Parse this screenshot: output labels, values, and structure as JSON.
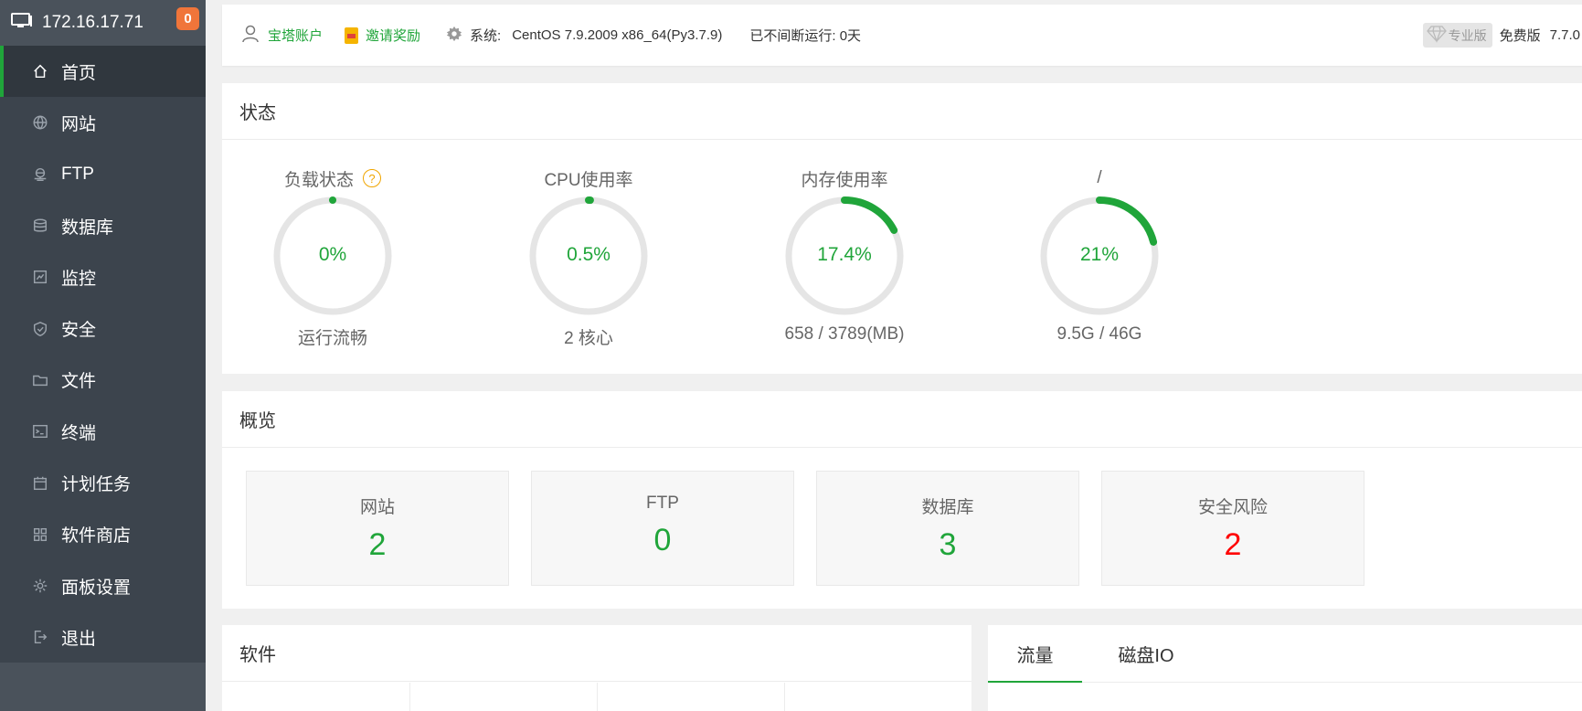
{
  "sidebar": {
    "ip": "172.16.17.71",
    "badge": "0",
    "items": [
      {
        "label": "首页",
        "icon": "home-icon"
      },
      {
        "label": "网站",
        "icon": "globe-icon"
      },
      {
        "label": "FTP",
        "icon": "ftp-icon"
      },
      {
        "label": "数据库",
        "icon": "database-icon"
      },
      {
        "label": "监控",
        "icon": "monitor-icon"
      },
      {
        "label": "安全",
        "icon": "shield-icon"
      },
      {
        "label": "文件",
        "icon": "folder-icon"
      },
      {
        "label": "终端",
        "icon": "terminal-icon"
      },
      {
        "label": "计划任务",
        "icon": "calendar-icon"
      },
      {
        "label": "软件商店",
        "icon": "apps-icon"
      },
      {
        "label": "面板设置",
        "icon": "gear-icon"
      },
      {
        "label": "退出",
        "icon": "logout-icon"
      }
    ]
  },
  "header": {
    "account": "宝塔账户",
    "invite": "邀请奖励",
    "system_label": "系统:",
    "system_value": "CentOS 7.9.2009 x86_64(Py3.7.9)",
    "uptime": "已不间断运行: 0天",
    "pro": "专业版",
    "free": "免费版",
    "version": "7.7.0"
  },
  "status": {
    "title": "状态",
    "gauges": [
      {
        "title": "负载状态",
        "value": "0%",
        "percent": 0,
        "sub": "运行流畅",
        "help": "?"
      },
      {
        "title": "CPU使用率",
        "value": "0.5%",
        "percent": 0.5,
        "sub": "2 核心"
      },
      {
        "title": "内存使用率",
        "value": "17.4%",
        "percent": 17.4,
        "sub": "658 / 3789(MB)"
      },
      {
        "title": "/",
        "value": "21%",
        "percent": 21,
        "sub": "9.5G / 46G"
      }
    ]
  },
  "overview": {
    "title": "概览",
    "cards": [
      {
        "label": "网站",
        "value": "2"
      },
      {
        "label": "FTP",
        "value": "0"
      },
      {
        "label": "数据库",
        "value": "3"
      },
      {
        "label": "安全风险",
        "value": "2"
      }
    ]
  },
  "software": {
    "title": "软件"
  },
  "traffic": {
    "tabs": [
      "流量",
      "磁盘IO"
    ]
  },
  "colors": {
    "accent": "#20a53a",
    "danger": "#ff0000",
    "sidebar": "#3c444d",
    "badge": "#f0753a"
  }
}
